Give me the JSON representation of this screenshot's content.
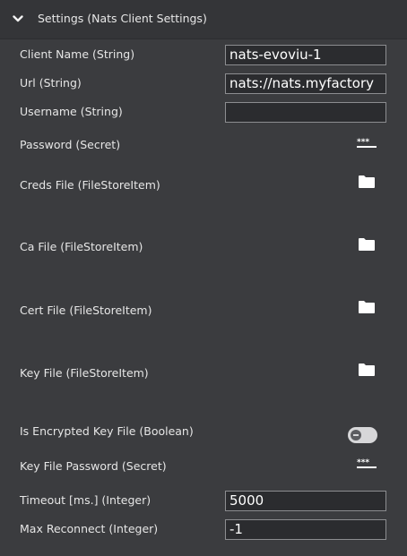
{
  "section": {
    "title": "Settings (Nats Client Settings)",
    "expanded": true
  },
  "fields": {
    "client_name": {
      "label": "Client Name (String)",
      "value": "nats-evoviu-1"
    },
    "url": {
      "label": "Url (String)",
      "value": "nats://nats.myfactory"
    },
    "username": {
      "label": "Username (String)",
      "value": ""
    },
    "password": {
      "label": "Password (Secret)",
      "icon": "secret-icon"
    },
    "creds_file": {
      "label": "Creds File (FileStoreItem)",
      "icon": "folder-icon"
    },
    "ca_file": {
      "label": "Ca File (FileStoreItem)",
      "icon": "folder-icon"
    },
    "cert_file": {
      "label": "Cert File (FileStoreItem)",
      "icon": "folder-icon"
    },
    "key_file": {
      "label": "Key File (FileStoreItem)",
      "icon": "folder-icon"
    },
    "is_encrypted_key_file": {
      "label": "Is Encrypted Key File (Boolean)",
      "checked": false
    },
    "key_file_password": {
      "label": "Key File Password (Secret)",
      "icon": "secret-icon"
    },
    "timeout": {
      "label": "Timeout [ms.] (Integer)",
      "value": "5000"
    },
    "max_reconnect": {
      "label": "Max Reconnect (Integer)",
      "value": "-1"
    }
  },
  "colors": {
    "panel_background": "#3b3c3f",
    "header_background": "#343538",
    "input_background": "#2b2c2f",
    "input_border": "#8c8d90",
    "text": "#e6e6e6",
    "icon": "#ffffff",
    "toggle_track": "#d7d7d9"
  }
}
